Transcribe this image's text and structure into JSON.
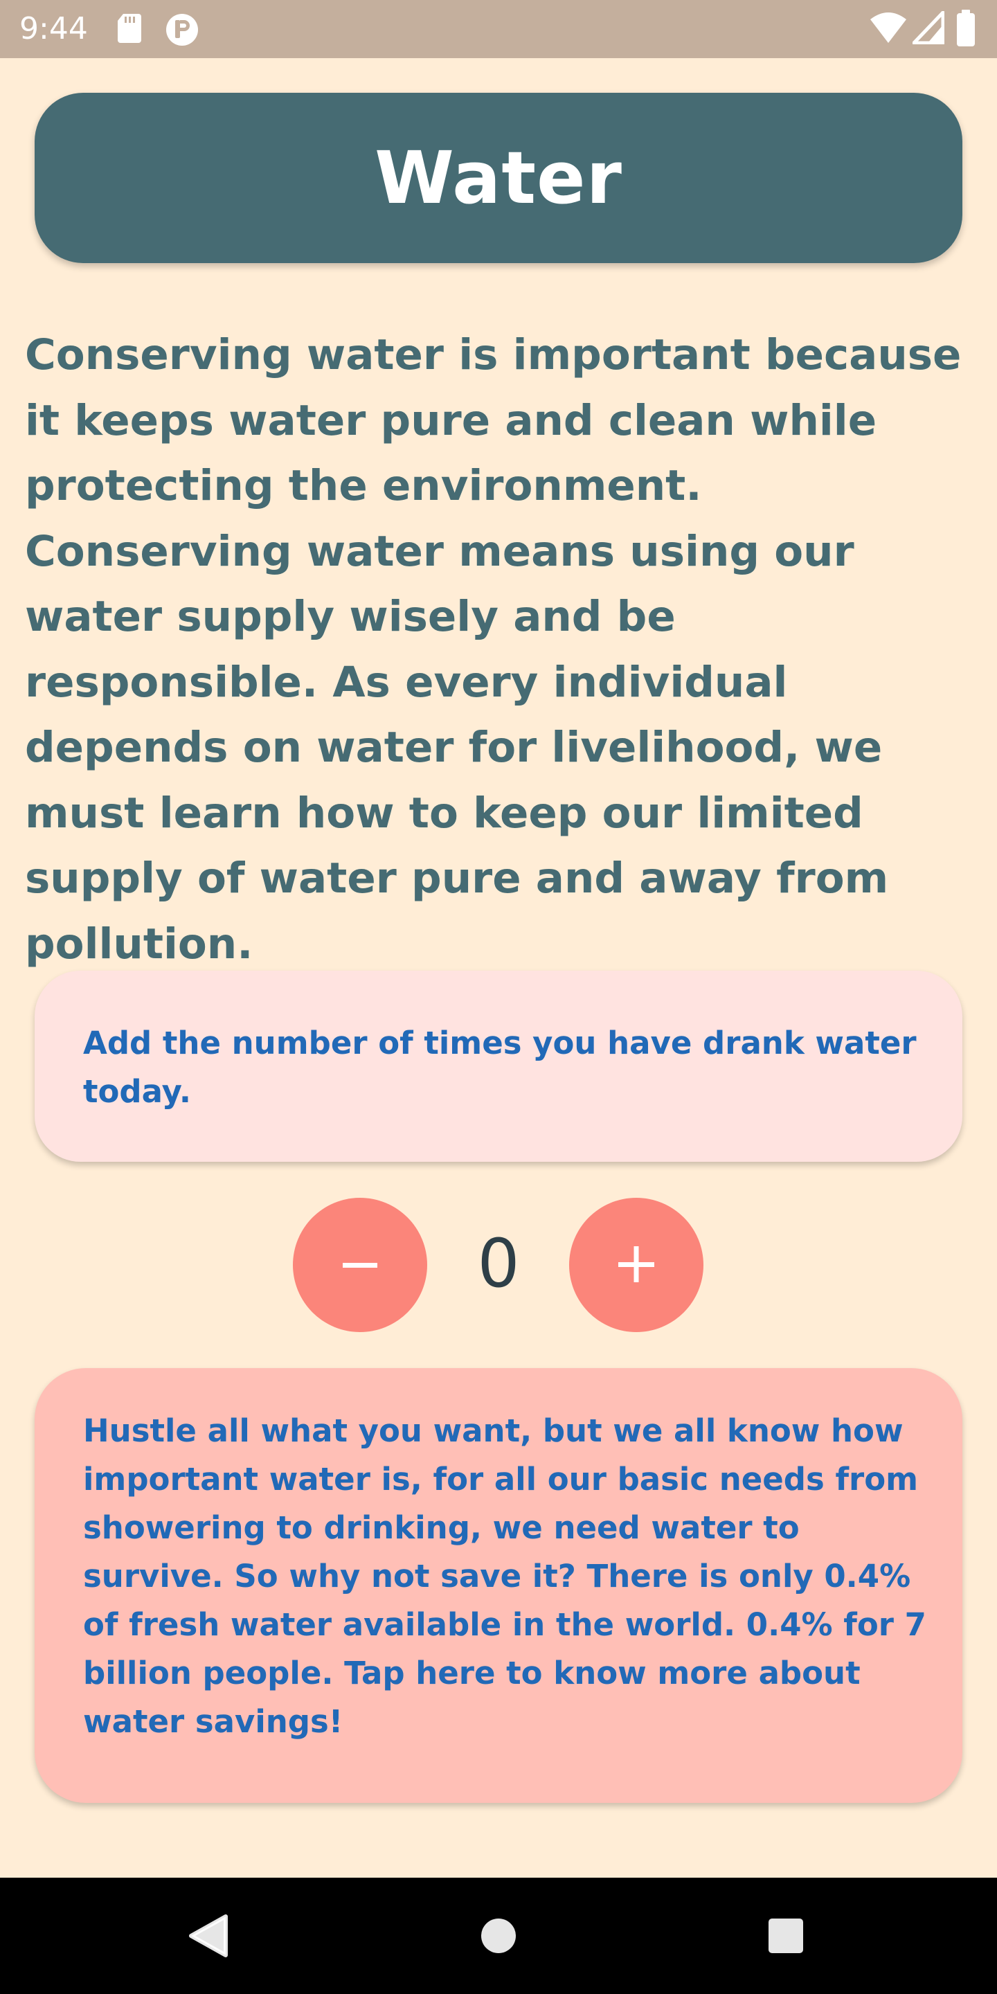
{
  "status_bar": {
    "time": "9:44",
    "left_icons": [
      "sd-card-icon",
      "notification-app-icon"
    ],
    "right_icons": [
      "wifi-icon",
      "cell-signal-icon",
      "battery-icon"
    ]
  },
  "header": {
    "title": "Water"
  },
  "description": "Conserving water is important because it keeps water pure and clean while protecting the environment. Conserving water means using our water supply wisely and be responsible. As every individual depends on water for livelihood, we must learn how to keep our limited supply of water pure and away from pollution.",
  "prompt_card": {
    "text": "Add the number of times you have drank water today."
  },
  "counter": {
    "value": "0",
    "decrement_icon": "minus-icon",
    "increment_icon": "plus-icon"
  },
  "info_card": {
    "text": "Hustle all what you want, but we all know how important water is, for all our basic needs from showering to drinking, we need water to survive. So why not save it? There is only 0.4% of fresh water available in the world. 0.4% for 7 billion people. Tap here to know more about water savings!"
  },
  "nav_bar": {
    "icons": [
      "back-icon",
      "home-icon",
      "recents-icon"
    ]
  },
  "colors": {
    "background": "#FFEDD6",
    "status_bar": "#C4AF9D",
    "header": "#466B73",
    "description_text": "#466B73",
    "prompt_card": "#FFE3E0",
    "card_text": "#2169B7",
    "counter_buttons": "#FB857A",
    "counter_text": "#2E3F47",
    "info_card": "#FFBFB6",
    "nav_bar": "#000000"
  }
}
